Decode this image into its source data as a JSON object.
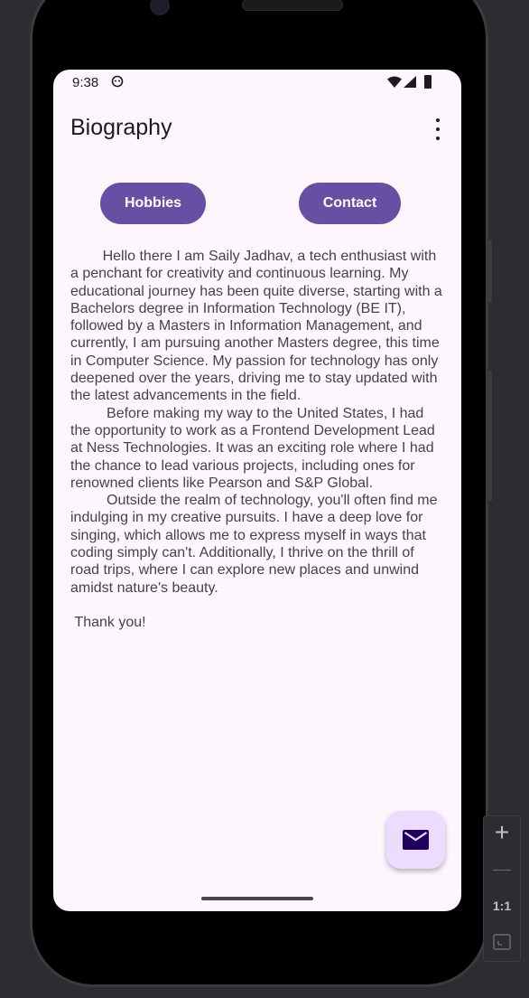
{
  "status_bar": {
    "time": "9:38",
    "icons": [
      "settings-icon",
      "wifi-icon",
      "signal-icon",
      "battery-icon"
    ]
  },
  "app_bar": {
    "title": "Biography",
    "menu_icon": "more-vert-icon"
  },
  "buttons": {
    "hobbies": "Hobbies",
    "contact": "Contact"
  },
  "bio": {
    "text": "        Hello there I am Saily Jadhav, a tech enthusiast with a penchant for creativity and continuous learning. My educational journey has been quite diverse, starting with a Bachelors degree in Information Technology (BE IT), followed by a Masters in Information Management, and currently, I am pursuing another Masters degree, this time in Computer Science. My passion for technology has only deepened over the years, driving me to stay updated with the latest advancements in the field.\n         Before making my way to the United States, I had the opportunity to work as a Frontend Development Lead at Ness Technologies. It was an exciting role where I had the chance to lead various projects, including ones for renowned clients like Pearson and S&P Global.\n         Outside the realm of technology, you'll often find me indulging in my creative pursuits. I have a deep love for singing, which allows me to express myself in ways that coding simply can't. Additionally, I thrive on the thrill of road trips, where I can explore new places and unwind amidst nature's beauty.\n\n Thank you!"
  },
  "fab": {
    "icon": "mail-icon"
  },
  "emulator_controls": {
    "zoom_in": "+",
    "zoom_reset": "1:1"
  },
  "colors": {
    "primary": "#6750a4",
    "fab_container": "#eaddff",
    "surface": "#fdf7fd"
  }
}
